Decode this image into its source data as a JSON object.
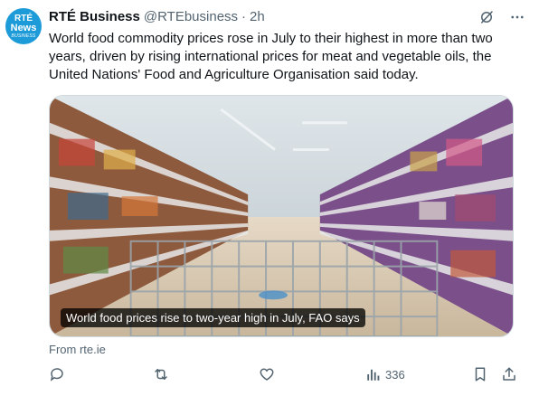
{
  "avatar": {
    "line1": "RTÉ",
    "line2": "News",
    "line3": "BUSINESS"
  },
  "author": {
    "name": "RTÉ Business",
    "handle": "@RTEbusiness",
    "separator": "·",
    "time": "2h"
  },
  "header_icons": [
    "grok-icon",
    "more-icon"
  ],
  "tweet_text": "World food commodity prices rose in July to their highest in more than two years, driven by rising international prices for meat and vegetable oils, the United Nations' Food and Agriculture Organisation said today.",
  "card": {
    "caption": "World food prices rise to two-year high in July, FAO says",
    "source": "From rte.ie"
  },
  "actions": {
    "views": "336"
  },
  "colors": {
    "avatar_bg": "#1d9bd8",
    "muted": "#536471",
    "text": "#0f1419"
  }
}
